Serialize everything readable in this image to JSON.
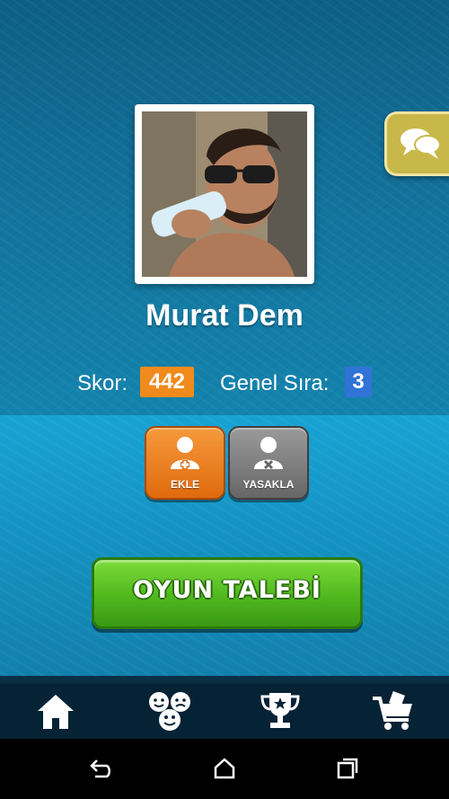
{
  "profile": {
    "name": "Murat Dem"
  },
  "stats": {
    "score_label": "Skor:",
    "score_value": "442",
    "rank_label": "Genel Sıra:",
    "rank_value": "3"
  },
  "actions": {
    "add_label": "EKLE",
    "ban_label": "YASAKLA"
  },
  "game_request": {
    "label": "OYUN TALEBİ"
  },
  "tabs": [
    {
      "icon": "home-icon"
    },
    {
      "icon": "smileys-icon"
    },
    {
      "icon": "trophy-icon"
    },
    {
      "icon": "shopping-cart-icon"
    }
  ],
  "colors": {
    "score_badge": "#f08a1c",
    "rank_badge": "#2f74d6",
    "add_button": "#e8761a",
    "ban_button": "#7a7a7a",
    "game_button": "#4fb81e",
    "chat_tab": "#c8b84a"
  }
}
